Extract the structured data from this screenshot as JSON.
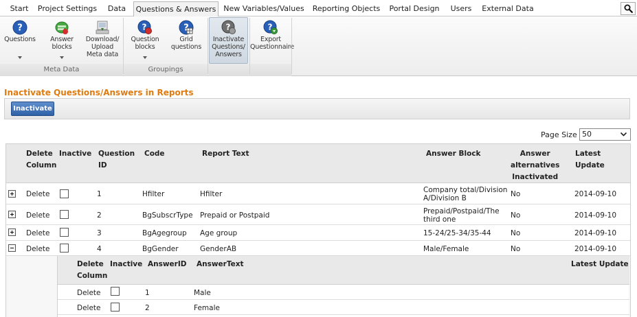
{
  "tabs": [
    {
      "label": "Start"
    },
    {
      "label": "Project Settings"
    },
    {
      "label": "Data"
    },
    {
      "label": "Questions & Answers",
      "active": true
    },
    {
      "label": "New Variables/Values"
    },
    {
      "label": "Reporting Objects"
    },
    {
      "label": "Portal Design"
    },
    {
      "label": "Users"
    },
    {
      "label": "External Data"
    }
  ],
  "ribbon": {
    "buttons": [
      {
        "label": "Questions",
        "icon": "question-icon",
        "dropdown": true
      },
      {
        "label": "Answer\nblocks",
        "icon": "answer-blocks-icon",
        "dropdown": true
      },
      {
        "label": "Download/\nUpload\nMeta data",
        "icon": "download-upload-icon",
        "dropdown": false
      },
      {
        "label": "Question\nblocks",
        "icon": "question-blocks-icon",
        "dropdown": true
      },
      {
        "label": "Grid\nquestions",
        "icon": "grid-questions-icon",
        "dropdown": false
      },
      {
        "label": "Inactivate\nQuestions/\nAnswers",
        "icon": "inactivate-icon",
        "dropdown": false,
        "active": true
      },
      {
        "label": "Export\nQuestionnaire",
        "icon": "export-icon",
        "dropdown": false
      }
    ],
    "groups": [
      {
        "label": "Meta Data"
      },
      {
        "label": "Groupings"
      }
    ]
  },
  "page": {
    "title": "Inactivate Questions/Answers in Reports",
    "inactivate_label": "Inactivate",
    "page_size_label": "Page Size",
    "page_size_value": "50"
  },
  "grid": {
    "headers": {
      "delete": "Delete\nColumn",
      "inactive": "Inactive",
      "question_id": "Question\nID",
      "code": "Code",
      "report_text": "Report Text",
      "answer_block": "Answer Block",
      "answer_alt": "Answer\nalternatives\nInactivated",
      "latest_update": "Latest\nUpdate"
    },
    "rows": [
      {
        "expanded": false,
        "delete": "Delete",
        "id": "1",
        "code": "Hfilter",
        "report_text": "Hfilter",
        "answer_block": "Company total/Division\nA/Division B",
        "answer_alt": "No",
        "latest_update": "2014-09-10"
      },
      {
        "expanded": false,
        "delete": "Delete",
        "id": "2",
        "code": "BgSubscrType",
        "report_text": "Prepaid or Postpaid",
        "answer_block": "Prepaid/Postpaid/The\nthird one",
        "answer_alt": "No",
        "latest_update": "2014-09-10"
      },
      {
        "expanded": false,
        "delete": "Delete",
        "id": "3",
        "code": "BgAgegroup",
        "report_text": "Age group",
        "answer_block": "15-24/25-34/35-44",
        "answer_alt": "No",
        "latest_update": "2014-09-10"
      },
      {
        "expanded": true,
        "delete": "Delete",
        "id": "4",
        "code": "BgGender",
        "report_text": "GenderAB",
        "answer_block": "Male/Female",
        "answer_alt": "No",
        "latest_update": "2014-09-10"
      }
    ],
    "detail": {
      "headers": {
        "delete": "Delete\nColumn",
        "inactive": "Inactive",
        "answer_id": "AnswerID",
        "answer_text": "AnswerText",
        "latest_update": "Latest Update"
      },
      "rows": [
        {
          "delete": "Delete",
          "answer_id": "1",
          "answer_text": "Male"
        },
        {
          "delete": "Delete",
          "answer_id": "2",
          "answer_text": "Female"
        }
      ]
    }
  },
  "colors": {
    "title_orange": "#e07b10",
    "button_blue": "#2f61a7",
    "header_gray": "#e9e9e9"
  }
}
